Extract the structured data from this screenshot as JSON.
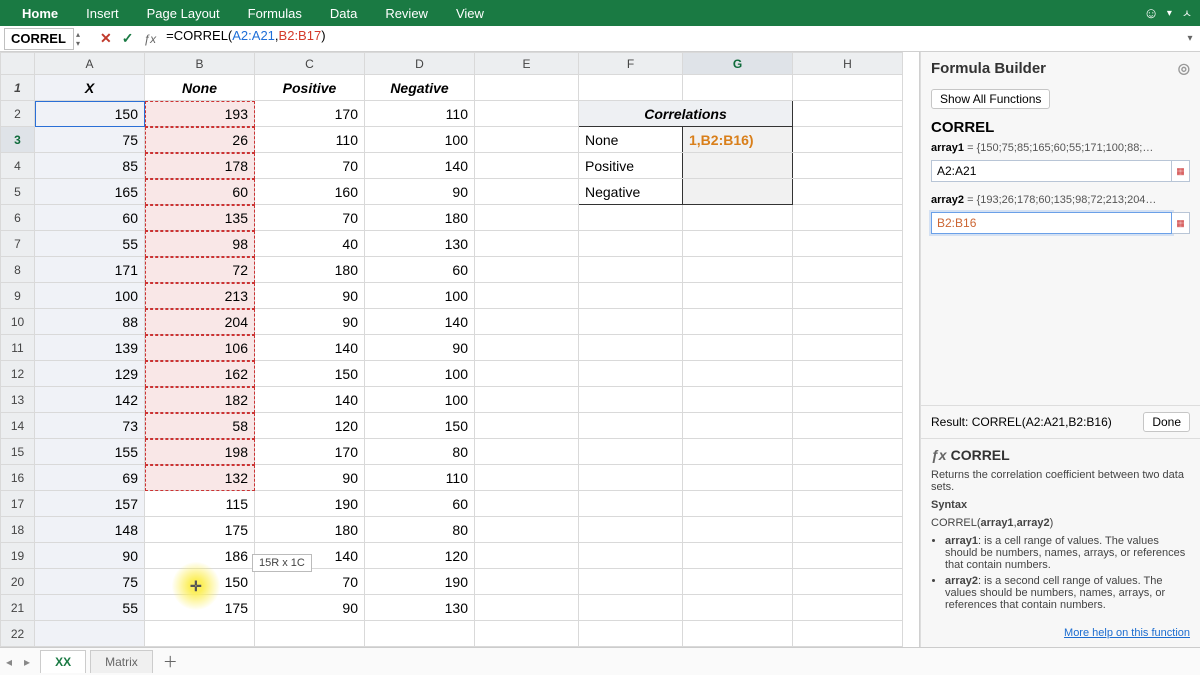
{
  "ribbon": {
    "tabs": [
      "Home",
      "Insert",
      "Page Layout",
      "Formulas",
      "Data",
      "Review",
      "View"
    ],
    "active": 0,
    "smile": "☺"
  },
  "namebox": "CORREL",
  "formula": {
    "pre": "=CORREL(",
    "r1": "A2:A21",
    "mid": ",",
    "r2": "B2:B17",
    "post": ")"
  },
  "columns": [
    "A",
    "B",
    "C",
    "D",
    "E",
    "F",
    "G",
    "H"
  ],
  "headers": {
    "A": "X",
    "B": "None",
    "C": "Positive",
    "D": "Negative"
  },
  "data": {
    "A": [
      150,
      75,
      85,
      165,
      60,
      55,
      171,
      100,
      88,
      139,
      129,
      142,
      73,
      155,
      69,
      157,
      148,
      90,
      75,
      55
    ],
    "B": [
      193,
      26,
      178,
      60,
      135,
      98,
      72,
      213,
      204,
      106,
      162,
      182,
      58,
      198,
      132,
      115,
      175,
      186,
      150,
      175
    ],
    "C": [
      170,
      110,
      70,
      160,
      70,
      40,
      180,
      90,
      90,
      140,
      150,
      140,
      120,
      170,
      90,
      190,
      180,
      140,
      70,
      90
    ],
    "D": [
      110,
      100,
      140,
      90,
      180,
      130,
      60,
      100,
      140,
      90,
      100,
      100,
      150,
      80,
      110,
      60,
      80,
      120,
      190,
      130
    ]
  },
  "corr": {
    "title": "Correlations",
    "rows": [
      "None",
      "Positive",
      "Negative"
    ],
    "active_val": "1,B2:B16)"
  },
  "range_tip": "15R x 1C",
  "panel": {
    "title": "Formula Builder",
    "show_all": "Show All Functions",
    "fn": "CORREL",
    "args": [
      {
        "name": "array1",
        "preview": "{150;75;85;165;60;55;171;100;88;…",
        "value": "A2:A21"
      },
      {
        "name": "array2",
        "preview": "{193;26;178;60;135;98;72;213;204…",
        "value": "B2:B16"
      }
    ],
    "result_label": "Result:",
    "result": "CORREL(A2:A21,B2:B16)",
    "done": "Done",
    "desc": "Returns the correlation coefficient between two data sets.",
    "syntax_h": "Syntax",
    "syntax": "CORREL(array1,array2)",
    "bullets": [
      {
        "b": "array1",
        "t": ": is a cell range of values. The values should be numbers, names, arrays, or references that contain numbers."
      },
      {
        "b": "array2",
        "t": ": is a second cell range of values. The values should be numbers, names, arrays, or references that contain numbers."
      }
    ],
    "more": "More help on this function"
  },
  "footer": {
    "tabs": [
      "XX",
      "Matrix"
    ],
    "active": 0
  }
}
